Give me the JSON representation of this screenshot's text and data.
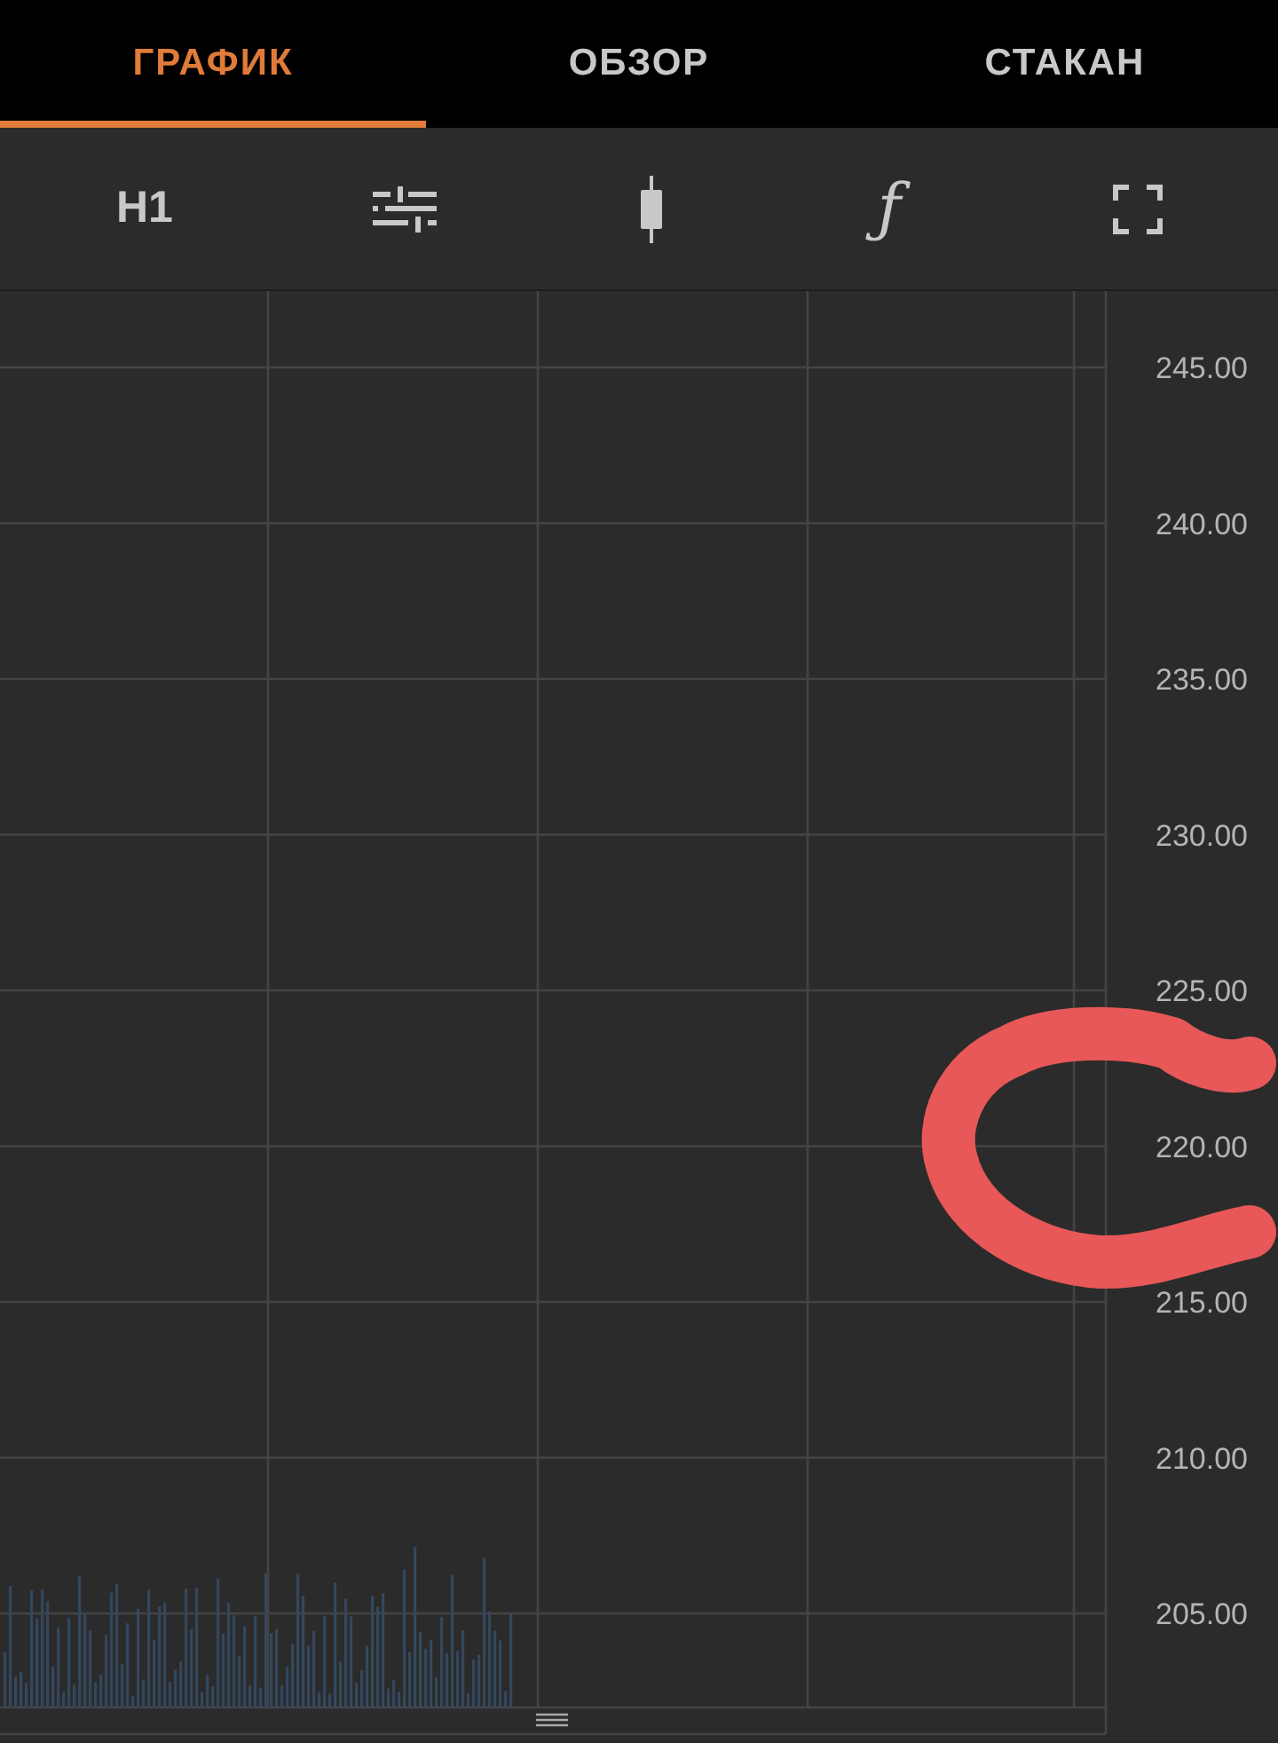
{
  "tabs": [
    {
      "label": "ГРАФИК",
      "selected": true
    },
    {
      "label": "ОБЗОР",
      "selected": false
    },
    {
      "label": "СТАКАН",
      "selected": false
    }
  ],
  "toolbar": {
    "timeframe": "H1",
    "function_symbol": "ƒ"
  },
  "price_axis": [
    "245.00",
    "240.00",
    "235.00",
    "230.00",
    "225.00",
    "220.00",
    "215.00",
    "210.00",
    "205.00"
  ]
}
